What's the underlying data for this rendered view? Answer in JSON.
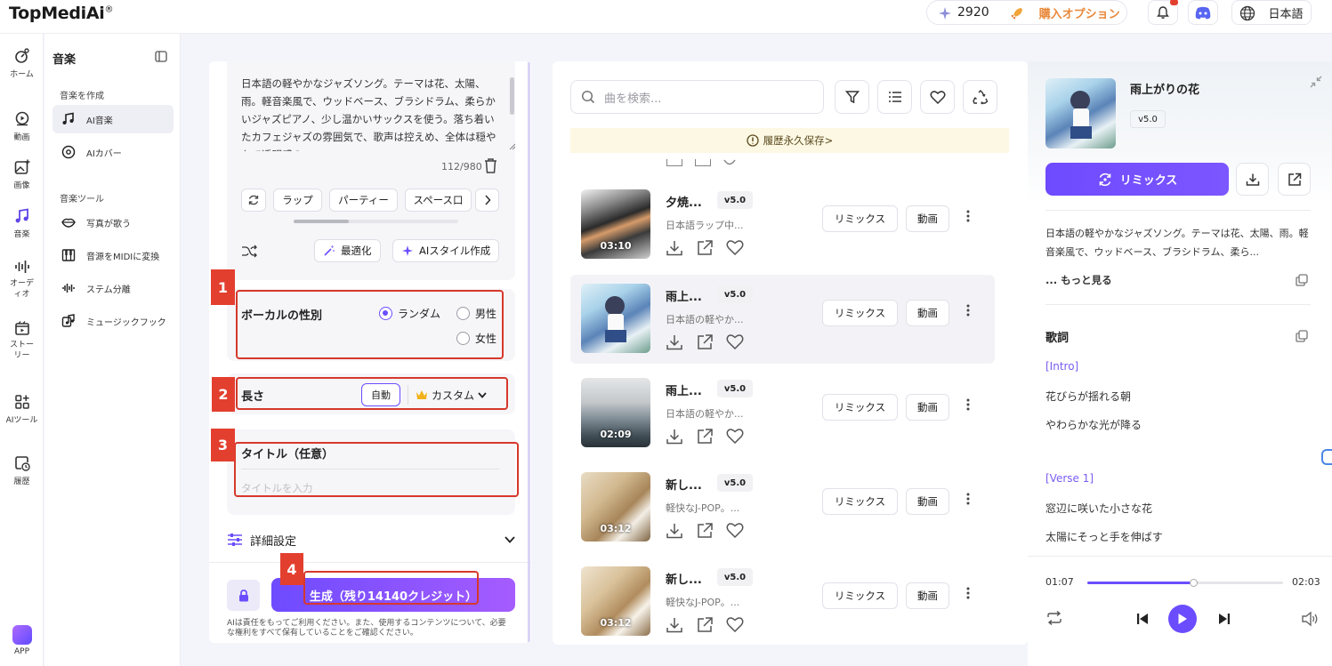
{
  "app": {
    "logo": "TopMediAi",
    "logo_reg": "®"
  },
  "topbar": {
    "credits": "2920",
    "buy_label": "購入オプション",
    "language": "日本語"
  },
  "leftnav": {
    "items": [
      {
        "label": "ホーム",
        "icon": "home-icon"
      },
      {
        "label": "動画",
        "icon": "video-icon"
      },
      {
        "label": "画像",
        "icon": "image-icon"
      },
      {
        "label": "音楽",
        "icon": "music-icon"
      },
      {
        "label": "オーディオ",
        "icon": "audio-icon"
      },
      {
        "label": "ストーリー",
        "icon": "story-icon"
      },
      {
        "label": "AIツール",
        "icon": "ai-tools-icon"
      },
      {
        "label": "履歴",
        "icon": "history-icon"
      },
      {
        "label": "APP",
        "icon": "app-icon"
      }
    ]
  },
  "subnav": {
    "title": "音楽",
    "section_create": "音楽を作成",
    "section_tools": "音楽ツール",
    "items": [
      {
        "label": "AI音楽"
      },
      {
        "label": "AIカバー"
      },
      {
        "label": "写真が歌う"
      },
      {
        "label": "音源をMIDIに変換"
      },
      {
        "label": "ステム分離"
      },
      {
        "label": "ミュージックフック"
      }
    ]
  },
  "composer": {
    "description": "日本語の軽やかなジャズソング。テーマは花、太陽、雨。軽音楽風で、ウッドベース、ブラシドラム、柔らかいジャズピアノ、少し温かいサックスを使う。落ち着いたカフェジャズの雰囲気で、歌声は控えめ、全体は穏やかで透明感の",
    "char_count": "112/980",
    "chips": [
      "ラップ",
      "パーティー",
      "スペース口"
    ],
    "optimize_label": "最適化",
    "ai_style_label": "AIスタイル作成",
    "vocal": {
      "label": "ボーカルの性別",
      "options": [
        "ランダム",
        "男性",
        "女性"
      ],
      "selected": "ランダム"
    },
    "length": {
      "label": "長さ",
      "auto": "自動",
      "custom": "カスタム"
    },
    "title_field": {
      "label": "タイトル（任意）",
      "placeholder": "タイトルを入力"
    },
    "advanced_label": "詳細設定",
    "generate_label": "生成（残り14140クレジット）",
    "disclaimer": "AIは責任をもってご利用ください。また、使用するコンテンツについて、必要な権利をすべて保有していることをご確認ください。",
    "badges": [
      "1",
      "2",
      "3",
      "4"
    ]
  },
  "songlist": {
    "search_placeholder": "曲を検索...",
    "history_notice": "履歴永久保存>",
    "remix_label": "リミックス",
    "video_label": "動画",
    "songs": [
      {
        "title": "夕焼...",
        "version": "v5.0",
        "subtitle": "日本語ラップ中...",
        "duration": "03:10"
      },
      {
        "title": "雨上...",
        "version": "v5.0",
        "subtitle": "日本語の軽やか...",
        "duration": ""
      },
      {
        "title": "雨上...",
        "version": "v5.0",
        "subtitle": "日本語の軽やか...",
        "duration": "02:09"
      },
      {
        "title": "新し...",
        "version": "v5.0",
        "subtitle": "軽快なJ-POP。...",
        "duration": "03:12"
      },
      {
        "title": "新し...",
        "version": "v5.0",
        "subtitle": "軽快なJ-POP。...",
        "duration": "03:12"
      }
    ]
  },
  "detail": {
    "title": "雨上がりの花",
    "version": "v5.0",
    "remix_label": "リミックス",
    "description": "日本語の軽やかなジャズソング。テーマは花、太陽、雨。軽音楽風で、ウッドベース、ブラシドラム、柔ら...",
    "more_label": "... もっと見る",
    "lyrics_title": "歌詞",
    "lyrics": [
      "[Intro]",
      "花びらが揺れる朝",
      "やわらかな光が降る",
      "[Verse 1]",
      "窓辺に咲いた小さな花",
      "太陽にそっと手を伸ばす"
    ]
  },
  "player": {
    "current": "01:07",
    "total": "02:03",
    "progress": 0.54
  },
  "colors": {
    "accent": "#6b4dff",
    "highlight": "#d6382c",
    "buy": "#e8883a"
  }
}
